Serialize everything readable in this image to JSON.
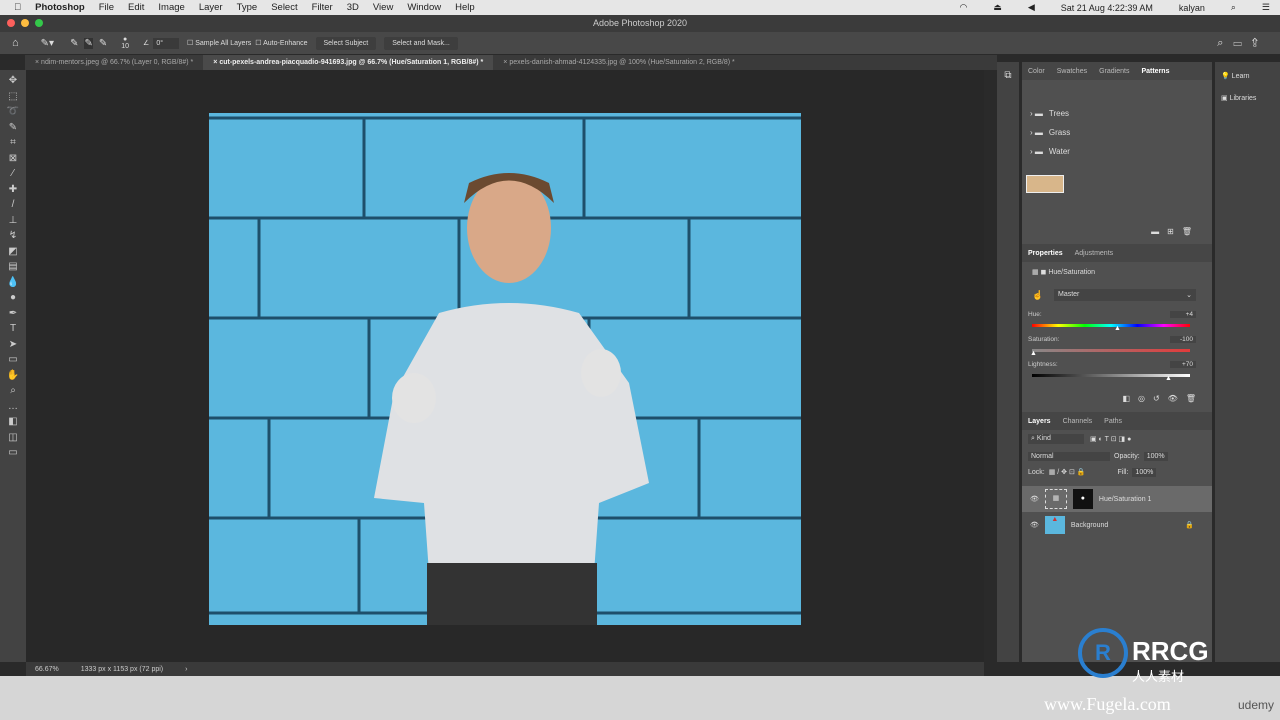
{
  "menubar": {
    "app": "Photoshop",
    "items": [
      "File",
      "Edit",
      "Image",
      "Layer",
      "Type",
      "Select",
      "Filter",
      "3D",
      "View",
      "Window",
      "Help"
    ],
    "datetime": "Sat 21 Aug  4:22:39 AM",
    "user": "kalyan"
  },
  "window": {
    "title": "Adobe Photoshop 2020"
  },
  "options": {
    "brush_size": "10",
    "angle": "0°",
    "sample_all": "Sample All Layers",
    "auto_enhance": "Auto-Enhance",
    "select_subject": "Select Subject",
    "select_mask": "Select and Mask..."
  },
  "tabs": [
    {
      "label": "ndim-mentors.jpeg @ 66.7% (Layer 0, RGB/8#) *"
    },
    {
      "label": "cut-pexels-andrea-piacquadio-941693.jpg @ 66.7% (Hue/Saturation 1, RGB/8#) *"
    },
    {
      "label": "pexels-danish-ahmad-4124335.jpg @ 100% (Hue/Saturation 2, RGB/8) *"
    }
  ],
  "status": {
    "zoom": "66.67%",
    "size": "1333 px x 1153 px (72 ppi)"
  },
  "swatches_panel": {
    "tabs": [
      "Color",
      "Swatches",
      "Gradients",
      "Patterns"
    ],
    "folders": [
      "Trees",
      "Grass",
      "Water"
    ]
  },
  "properties": {
    "tabs": [
      "Properties",
      "Adjustments"
    ],
    "title": "Hue/Saturation",
    "preset": "Master",
    "hue_label": "Hue:",
    "hue": "+4",
    "hue_value": 4,
    "sat_label": "Saturation:",
    "saturation": "-100",
    "saturation_value": -100,
    "light_label": "Lightness:",
    "lightness": "+70",
    "lightness_value": 70
  },
  "layers": {
    "tabs": [
      "Layers",
      "Channels",
      "Paths"
    ],
    "kind": "Kind",
    "blend": "Normal",
    "opacity_label": "Opacity:",
    "opacity": "100%",
    "lock_label": "Lock:",
    "fill_label": "Fill:",
    "fill": "100%",
    "items": [
      {
        "name": "Hue/Saturation 1"
      },
      {
        "name": "Background"
      }
    ]
  },
  "far_right": {
    "learn": "Learn",
    "libraries": "Libraries"
  },
  "watermark": {
    "site": "www.Fugela.com",
    "brand": "RRCG",
    "sub": "人人素材",
    "udemy": "udemy"
  }
}
